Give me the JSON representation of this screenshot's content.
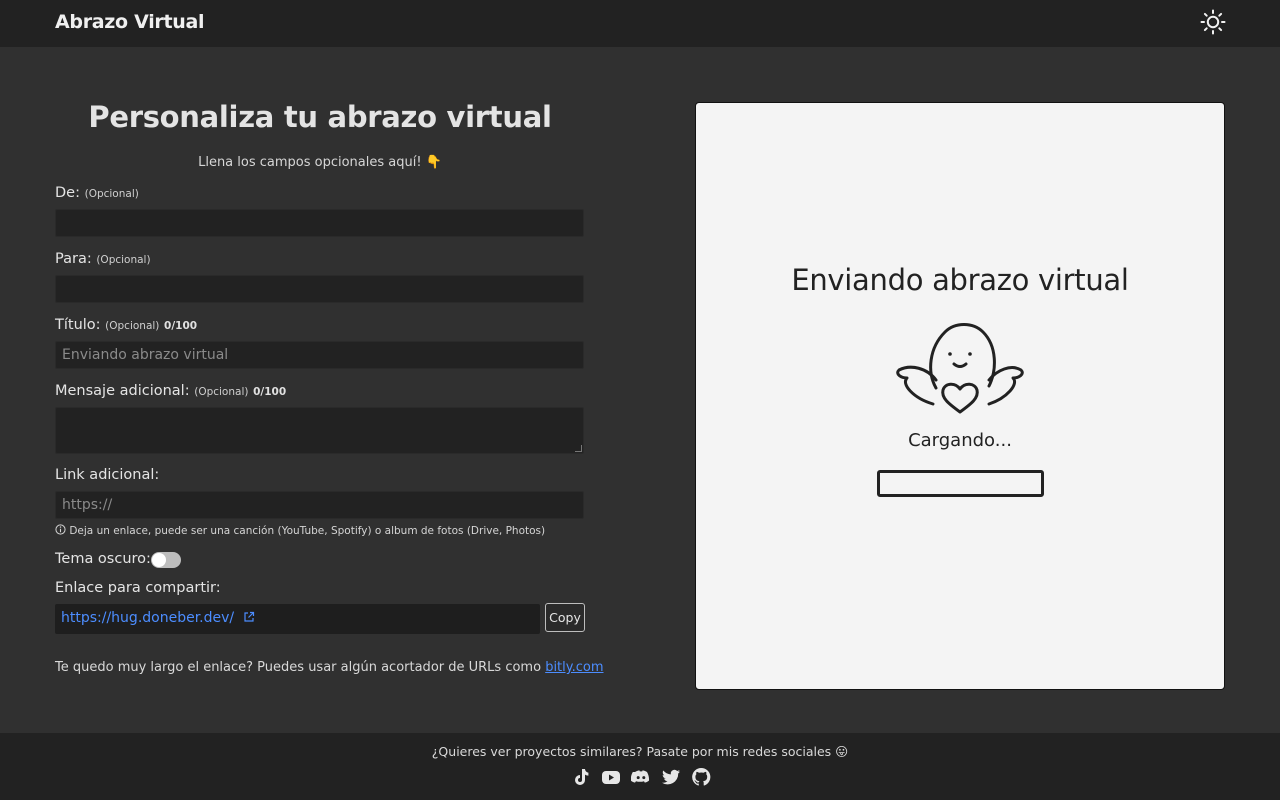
{
  "navbar": {
    "brand": "Abrazo Virtual",
    "theme_icon": "sun-icon"
  },
  "form": {
    "title": "Personaliza tu abrazo virtual",
    "subtitle": "Llena los campos opcionales aquí! 👇",
    "optional_tag": "(Opcional)",
    "from": {
      "label": "De:",
      "value": ""
    },
    "to": {
      "label": "Para:",
      "value": ""
    },
    "heading": {
      "label": "Título:",
      "counter": "0/100",
      "placeholder": "Enviando abrazo virtual"
    },
    "message": {
      "label": "Mensaje adicional:",
      "counter": "0/100",
      "value": ""
    },
    "link": {
      "label": "Link adicional:",
      "placeholder": "https://",
      "hint": "Deja un enlace, puede ser una canción (YouTube, Spotify) o album de fotos (Drive, Photos)",
      "hint_icon": "info-icon"
    },
    "dark_theme": {
      "label": "Tema oscuro:",
      "enabled": false
    },
    "share": {
      "label": "Enlace para compartir:",
      "url": "https://hug.doneber.dev/",
      "copy_label": "Copy"
    },
    "note": {
      "text": "Te quedo muy largo el enlace? Puedes usar algún acortador de URLs como",
      "link_text": "bitly.com"
    }
  },
  "preview": {
    "title": "Enviando abrazo virtual",
    "loading_text": "Cargando...",
    "progress": 0
  },
  "footer": {
    "text": "¿Quieres ver proyectos similares? Pasate por mis redes sociales 😛",
    "socials": [
      "tiktok-icon",
      "youtube-icon",
      "discord-icon",
      "twitter-icon",
      "github-icon"
    ]
  },
  "colors": {
    "page_bg": "#303030",
    "bar_bg": "#222222",
    "link": "#4c8dff",
    "preview_bg": "#f4f4f4"
  }
}
